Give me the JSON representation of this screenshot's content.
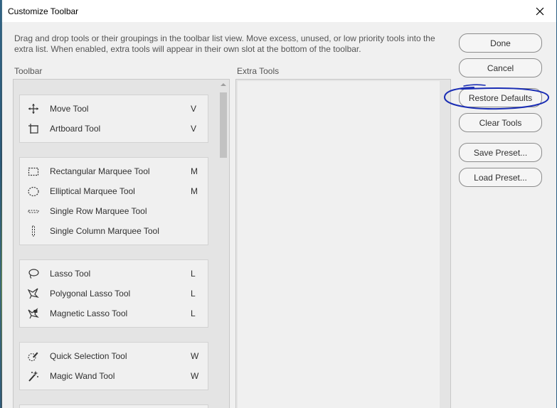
{
  "window": {
    "title": "Customize Toolbar",
    "close_glyph": "✕"
  },
  "description": "Drag and drop tools or their groupings in the toolbar list view. Move excess, unused, or low priority tools into the extra list. When enabled, extra tools will appear in their own slot at the bottom of the toolbar.",
  "toolbar_label": "Toolbar",
  "extra_label": "Extra Tools",
  "tool_groups": [
    {
      "tools": [
        {
          "name": "Move Tool",
          "key": "V",
          "icon": "move-icon"
        },
        {
          "name": "Artboard Tool",
          "key": "V",
          "icon": "artboard-icon"
        }
      ]
    },
    {
      "tools": [
        {
          "name": "Rectangular Marquee Tool",
          "key": "M",
          "icon": "rectangular-marquee-icon"
        },
        {
          "name": "Elliptical Marquee Tool",
          "key": "M",
          "icon": "elliptical-marquee-icon"
        },
        {
          "name": "Single Row Marquee Tool",
          "key": "",
          "icon": "single-row-marquee-icon"
        },
        {
          "name": "Single Column Marquee Tool",
          "key": "",
          "icon": "single-column-marquee-icon"
        }
      ]
    },
    {
      "tools": [
        {
          "name": "Lasso Tool",
          "key": "L",
          "icon": "lasso-icon"
        },
        {
          "name": "Polygonal Lasso Tool",
          "key": "L",
          "icon": "polygonal-lasso-icon"
        },
        {
          "name": "Magnetic Lasso Tool",
          "key": "L",
          "icon": "magnetic-lasso-icon"
        }
      ]
    },
    {
      "tools": [
        {
          "name": "Quick Selection Tool",
          "key": "W",
          "icon": "quick-selection-icon"
        },
        {
          "name": "Magic Wand Tool",
          "key": "W",
          "icon": "magic-wand-icon"
        }
      ]
    }
  ],
  "buttons": {
    "done": "Done",
    "cancel": "Cancel",
    "restore": "Restore Defaults",
    "clear": "Clear Tools",
    "save": "Save Preset...",
    "load": "Load Preset..."
  },
  "colors": {
    "annotation": "#1a2db4",
    "window_border": "#2b5f84"
  }
}
